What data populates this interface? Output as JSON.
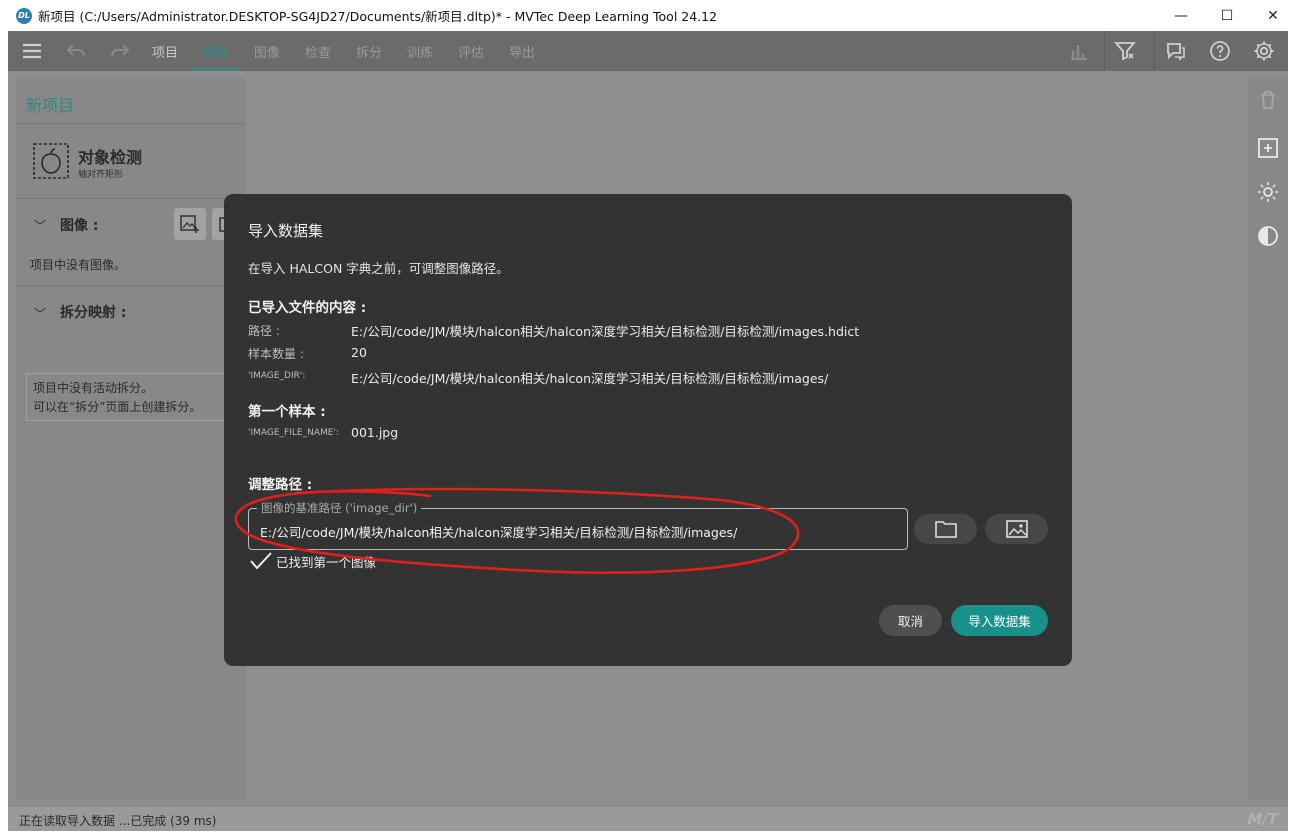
{
  "window": {
    "logo_text": "DL",
    "title": "新项目 (C:/Users/Administrator.DESKTOP-SG4JD27/Documents/新项目.dltp)* - MVTec Deep Learning Tool 24.12",
    "minimize": "—",
    "maximize": "☐",
    "close": "✕"
  },
  "toolbar": {
    "tabs": [
      "项目",
      "图库",
      "图像",
      "检查",
      "拆分",
      "训练",
      "评估",
      "导出"
    ],
    "active_tab": "图库"
  },
  "left_panel": {
    "project_name": "新项目",
    "task_name": "对象检测",
    "task_sub": "轴对齐矩形",
    "images_header": "图像 :",
    "images_empty": "项目中没有图像。",
    "split_header": "拆分映射 :",
    "split_empty_1": "项目中没有活动拆分。",
    "split_empty_2": "可以在“拆分”页面上创建拆分。"
  },
  "status": {
    "text": "正在读取导入数据 ...已完成 (39 ms)",
    "logo": "M/T"
  },
  "dialog": {
    "title": "导入数据集",
    "description": "在导入 HALCON 字典之前，可调整图像路径。",
    "imported_header": "已导入文件的内容 :",
    "path_label": "路径 :",
    "path_value": "E:/公司/code/JM/模块/halcon相关/halcon深度学习相关/目标检测/目标检测/images.hdict",
    "samples_label": "样本数量 :",
    "samples_value": "20",
    "image_dir_label": "'IMAGE_DIR':",
    "image_dir_value": "E:/公司/code/JM/模块/halcon相关/halcon深度学习相关/目标检测/目标检测/images/",
    "first_sample_header": "第一个样本 :",
    "image_file_label": "'IMAGE_FILE_NAME':",
    "image_file_value": "001.jpg",
    "adjust_header": "调整路径 :",
    "base_path_legend": "图像的基准路径 ('image_dir')",
    "base_path_value": "E:/公司/code/JM/模块/halcon相关/halcon深度学习相关/目标检测/目标检测/images/",
    "found_text": "已找到第一个图像",
    "cancel_label": "取消",
    "import_label": "导入数据集"
  },
  "colors": {
    "accent": "#17918a",
    "dialog_bg": "#333333",
    "annotation": "#e0201b"
  }
}
